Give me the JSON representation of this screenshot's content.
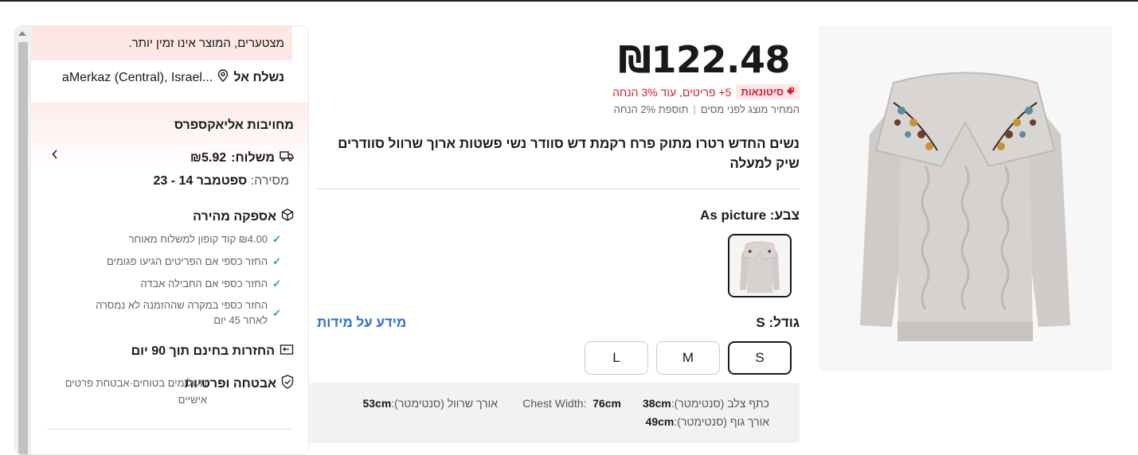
{
  "price": "₪122.48",
  "promo": {
    "badge": "סיטונאות",
    "text": "5+ פריטים, עוד 3% הנחה"
  },
  "tax": {
    "note": "המחיר מוצג לפני מסים",
    "extra": "תוספת 2% הנחה"
  },
  "product_title": "נשים החדש רטרו מתוק פרח רקמת דש סוודר נשי פשטות ארוך שרוול סוודרים שיק למעלה",
  "color": {
    "label": "צבע:",
    "value": "As picture"
  },
  "size": {
    "label": "גודל:",
    "value": "S",
    "guide_link": "מידע על מידות",
    "options": [
      "S",
      "M",
      "L"
    ],
    "selected": "S"
  },
  "measurements": {
    "shoulder_label": "כתף צלב (סנטימטר):",
    "shoulder_value": "38cm",
    "chest_label": "Chest Width:",
    "chest_value": "76cm",
    "sleeve_label": "אורך שרוול (סנטימטר):",
    "sleeve_value": "53cm",
    "body_label": "אורך גוף (סנטימטר):",
    "body_value": "49cm"
  },
  "sidebar": {
    "notice": "מצטערים, המוצר אינו זמין יותר.",
    "ship_to_label": "נשלח אל",
    "ship_to_value": "aMerkaz (Central), Israel...",
    "commitment_title": "מחויבות אליאקספרס",
    "shipping_label": "משלוח:",
    "shipping_value": "₪5.92",
    "delivery_label": "מסירה:",
    "delivery_value": "ספטמבר 14 - 23",
    "fast_delivery": "אספקה מהירה",
    "checks": [
      "₪4.00 קוד קופון למשלוח מאוחר",
      "החזר כספי אם הפריטים הגיעו פגומים",
      "החזר כספי אם החבילה אבדה",
      "החזר כספי במקרה שההזמנה לא נמסרה לאחר 45 יום"
    ],
    "returns": "החזרות בחינם תוך 90 יום",
    "security_title": "אבטחה ופרטיות",
    "security_text": "תשלומים בטוחים·אבטחת פרטים אישיים"
  },
  "colors": {
    "accent_red": "#e0172f",
    "link_blue": "#2a6fd6",
    "check_green": "#1ba97a"
  },
  "icons": [
    "location-pin-icon",
    "truck-icon",
    "box-icon",
    "return-icon",
    "shield-icon",
    "chevron-left-icon",
    "tag-icon"
  ]
}
